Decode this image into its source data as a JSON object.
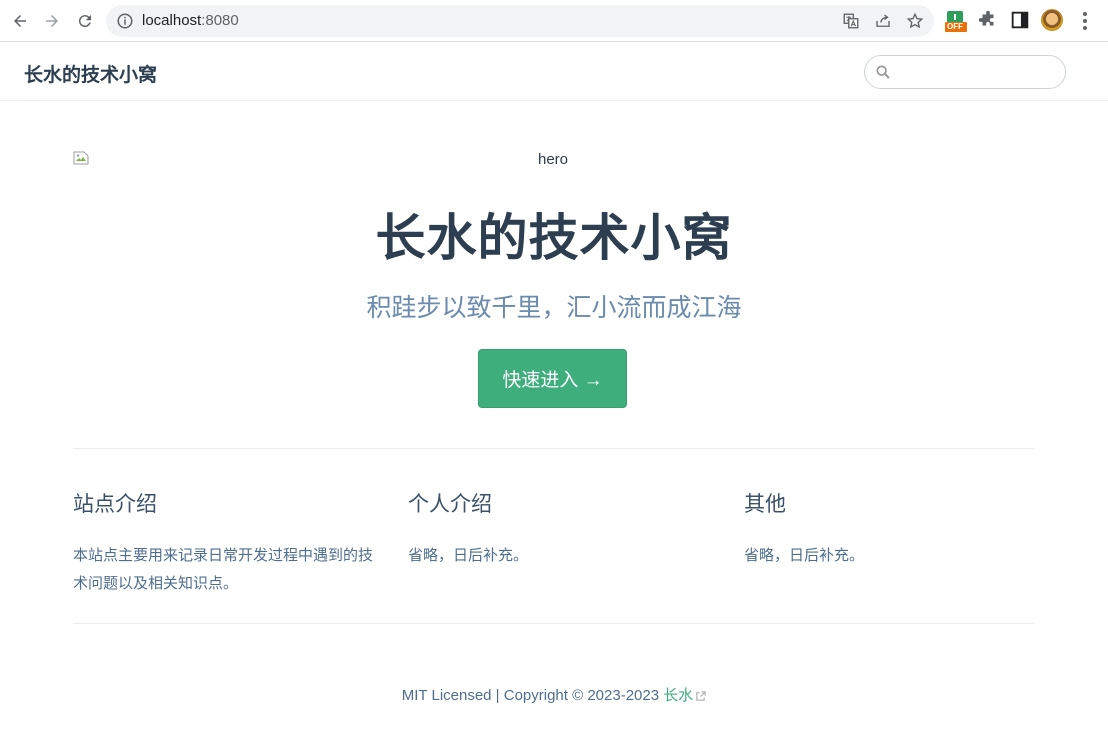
{
  "browser": {
    "url_host": "localhost",
    "url_port": ":8080",
    "extension_badge": "OFF"
  },
  "navbar": {
    "site_name": "长水的技术小窝",
    "search_placeholder": ""
  },
  "hero": {
    "image_alt": "hero",
    "title": "长水的技术小窝",
    "description": "积跬步以致千里，汇小流而成江海",
    "action_label": "快速进入 →"
  },
  "features": [
    {
      "title": "站点介绍",
      "details": "本站点主要用来记录日常开发过程中遇到的技术问题以及相关知识点。"
    },
    {
      "title": "个人介绍",
      "details": "省略，日后补充。"
    },
    {
      "title": "其他",
      "details": "省略，日后补充。"
    }
  ],
  "footer": {
    "text": "MIT Licensed | Copyright © 2023-2023 ",
    "link_text": "长水"
  },
  "colors": {
    "accent": "#3eaf7c",
    "text": "#2c3e50",
    "description": "#6a8bad"
  }
}
